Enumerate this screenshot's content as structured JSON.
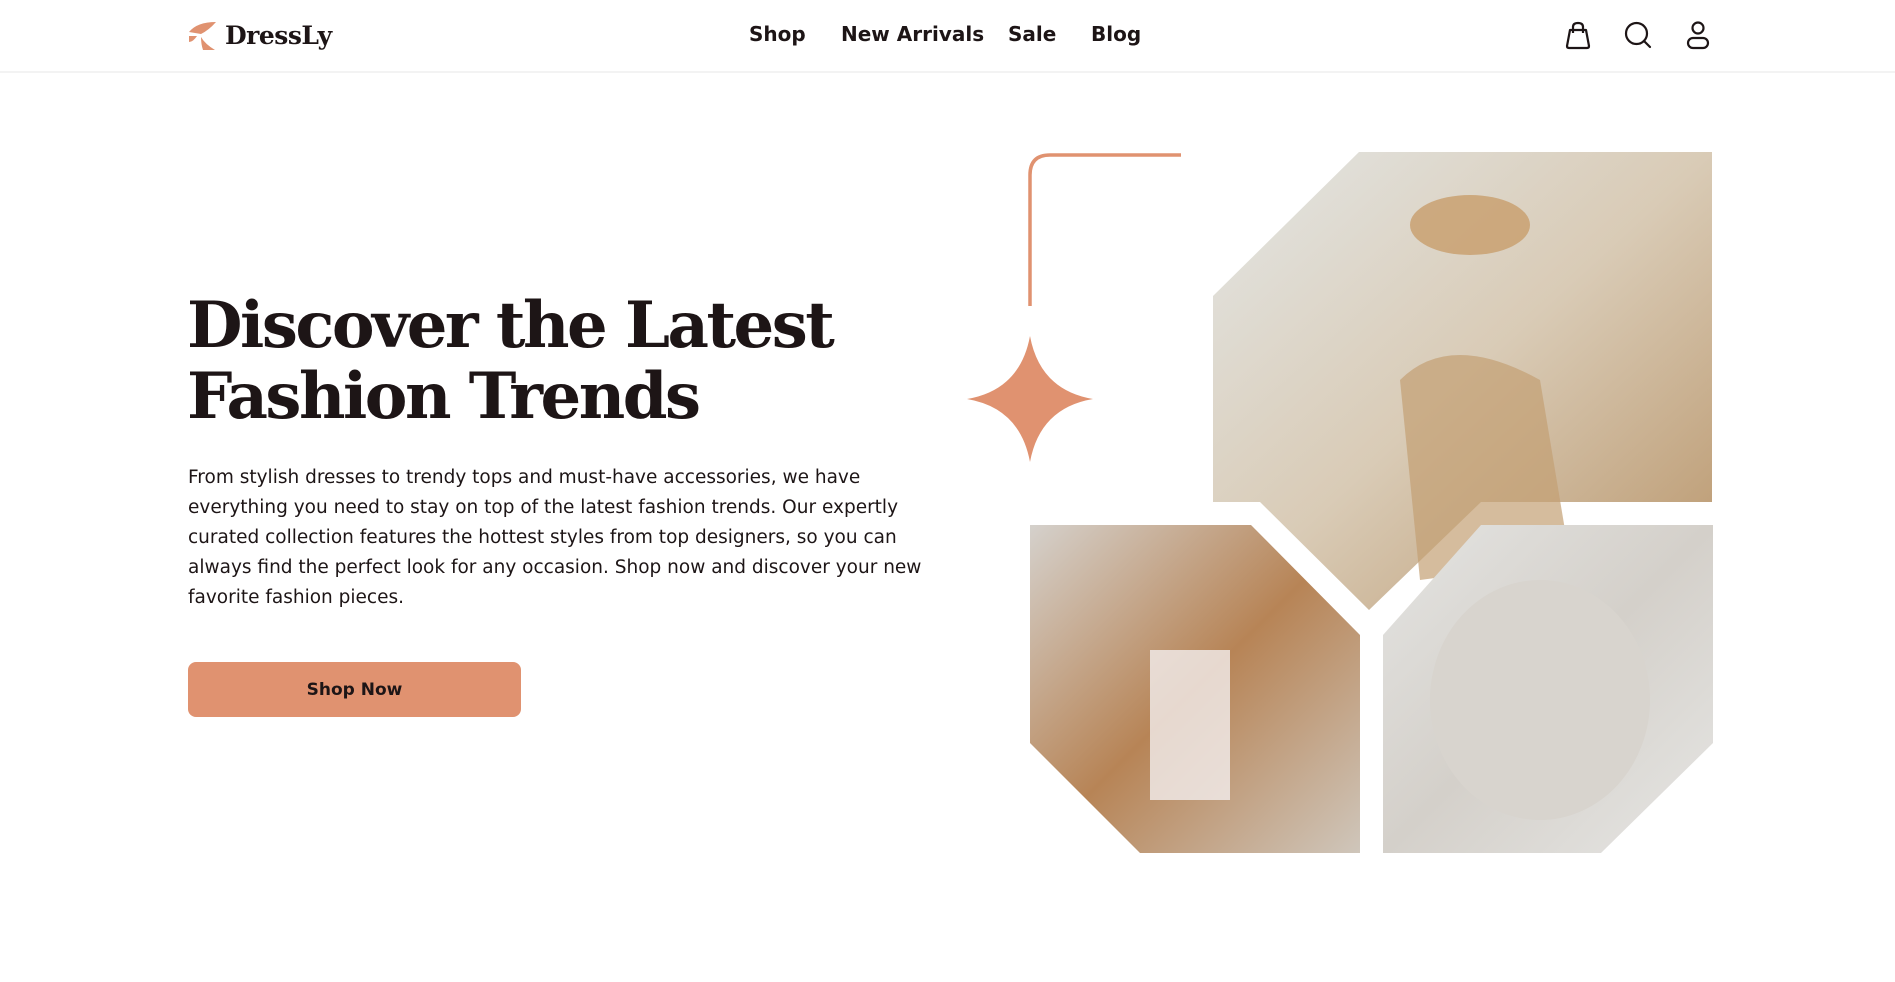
{
  "brand": {
    "name": "DressLy",
    "accent": "#e09270"
  },
  "nav": {
    "links": [
      "Shop",
      "New Arrivals",
      "Sale",
      "Blog"
    ],
    "icons": [
      "shopping-bag-icon",
      "search-icon",
      "user-icon"
    ]
  },
  "hero": {
    "title_line1": "Discover the Latest",
    "title_line2": "Fashion Trends",
    "description": "From stylish dresses to trendy tops and must-have accessories, we have everything you need to stay on top of the latest fashion trends. Our expertly curated collection features the hottest styles from top designers, so you can always find the perfect look for any occasion. Shop now and discover your new favorite fashion pieces.",
    "cta": "Shop Now"
  }
}
